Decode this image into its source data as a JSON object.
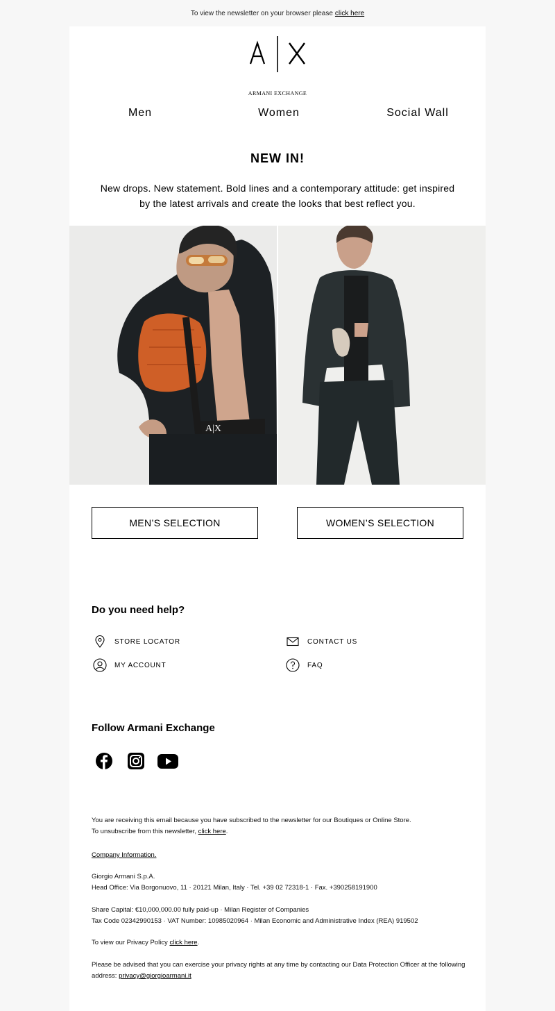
{
  "preheader": {
    "text": "To view the newsletter on your browser please",
    "link": "click here"
  },
  "brand": {
    "logo_text": "A|X",
    "name": "ARMANI EXCHANGE"
  },
  "nav": {
    "men": "Men",
    "women": "Women",
    "social": "Social Wall"
  },
  "hero": {
    "title": "NEW IN!",
    "body": "New drops. New statement. Bold lines and a contemporary attitude: get inspired by the latest arrivals and create the looks that best reflect you."
  },
  "buttons": {
    "men": "MEN’S SELECTION",
    "women": "WOMEN’S SELECTION"
  },
  "help": {
    "title": "Do you need help?",
    "store_locator": "STORE LOCATOR",
    "contact_us": "CONTACT US",
    "my_account": "MY ACCOUNT",
    "faq": "FAQ"
  },
  "follow": {
    "title": "Follow Armani Exchange",
    "icons": [
      "facebook-icon",
      "instagram-icon",
      "youtube-icon"
    ]
  },
  "footer": {
    "line1": "You are receiving this email because you have subscribed to the newsletter for our Boutiques or Online Store.",
    "line2_prefix": "To unsubscribe from this newsletter,",
    "line2_link": "click here",
    "company_info": "Company Information.",
    "company_name": "Giorgio Armani S.p.A.",
    "head_office": "Head Office: Via Borgonuovo, 11 · 20121 Milan, Italy · Tel. +39 02 72318-1 · Fax. +390258191900",
    "share_capital": "Share Capital: €10,000,000.00 fully paid-up · Milan Register of Companies",
    "tax_code": "Tax Code 02342990153 · VAT Number: 10985020964 · Milan Economic and Administrative Index (REA) 919502",
    "privacy_prefix": "To view our Privacy Policy",
    "privacy_link": "click here",
    "rights_text": "Please be advised that you can exercise your privacy rights at any time by contacting our Data Protection Officer at the following address:",
    "rights_email": "privacy@giorgioarmani.it"
  },
  "colors": {
    "page_bg": "#f7f7f7",
    "card_bg": "#ffffff",
    "text": "#000000"
  }
}
